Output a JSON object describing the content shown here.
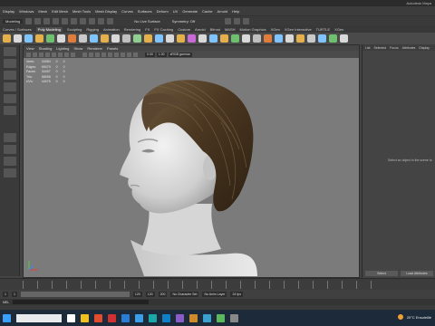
{
  "window": {
    "title": "Autodesk Maya"
  },
  "menubar": {
    "items": [
      "Display",
      "Windows",
      "Mesh",
      "Edit Mesh",
      "Mesh Tools",
      "Mesh Display",
      "Curves",
      "Surfaces",
      "Deform",
      "UV",
      "Generate",
      "Cache",
      "Arnold",
      "Help"
    ]
  },
  "statusline": {
    "mode": "Modeling",
    "live_surface": "No Live Surface",
    "symmetry": "Symmetry: Off"
  },
  "shelf": {
    "tabs": [
      "Curves / Surfaces",
      "Poly Modeling",
      "Sculpting",
      "Rigging",
      "Animation",
      "Rendering",
      "FX",
      "FX Caching",
      "Custom",
      "Arnold",
      "Bifrost",
      "MASH",
      "Motion Graphics",
      "XGen",
      "XGen Interactive",
      "TURTLE",
      "XGen"
    ],
    "active_tab": "Poly Modeling",
    "button_colors": [
      "#e3b04b",
      "#d9d9d9",
      "#7fc3ff",
      "#e3b04b",
      "#6ec06e",
      "#d9d9d9",
      "#e07d3c",
      "#c9c9c9",
      "#7fc3ff",
      "#e3b04b",
      "#d9d9d9",
      "#bfbfbf",
      "#8fcf8f",
      "#e3b04b",
      "#7fc3ff",
      "#d9d9d9",
      "#e3b04b",
      "#c96bd6",
      "#d9d9d9",
      "#7fc3ff",
      "#e3b04b",
      "#6ec06e",
      "#d9d9d9",
      "#bfbfbf",
      "#e07d3c",
      "#7fc3ff",
      "#d9d9d9",
      "#e3b04b",
      "#c9c9c9",
      "#7fc3ff",
      "#6ec06e",
      "#d9d9d9"
    ]
  },
  "viewport": {
    "menu": [
      "View",
      "Shading",
      "Lighting",
      "Show",
      "Renderer",
      "Panels"
    ],
    "field_a": "0.00",
    "field_b": "1.00",
    "color_space": "sRGB gamma",
    "hud": [
      {
        "label": "Verts:",
        "v1": "34984",
        "v2": "0",
        "v3": "0"
      },
      {
        "label": "Edges:",
        "v1": "69479",
        "v2": "0",
        "v3": "0"
      },
      {
        "label": "Faces:",
        "v1": "34497",
        "v2": "0",
        "v3": "0"
      },
      {
        "label": "Tris:",
        "v1": "68998",
        "v2": "0",
        "v3": "0"
      },
      {
        "label": "UVs:",
        "v1": "44075",
        "v2": "0",
        "v3": "0"
      }
    ]
  },
  "right_panel": {
    "tabs": [
      "List",
      "Selected",
      "Focus",
      "Attributes",
      "Display"
    ],
    "message": "Select an object in the scene to",
    "buttons": [
      "Select",
      "Load Attributes"
    ]
  },
  "range": {
    "start": "1",
    "min": "120",
    "max": "120",
    "end": "200",
    "character_set": "No Character Set",
    "anim_layer": "No Anim Layer",
    "fps": "24 fps"
  },
  "command": {
    "label": "MEL"
  },
  "taskbar": {
    "app_colors": [
      "#ffffff",
      "#f0c020",
      "#e04c2c",
      "#d03030",
      "#2b7cd3",
      "#3c9ee6",
      "#1aa7a7",
      "#0f7fc8",
      "#8a5cc7",
      "#d08a2a",
      "#3aa0d0",
      "#5cb85c",
      "#888888"
    ],
    "weather": "20°C Ensoleillé"
  }
}
